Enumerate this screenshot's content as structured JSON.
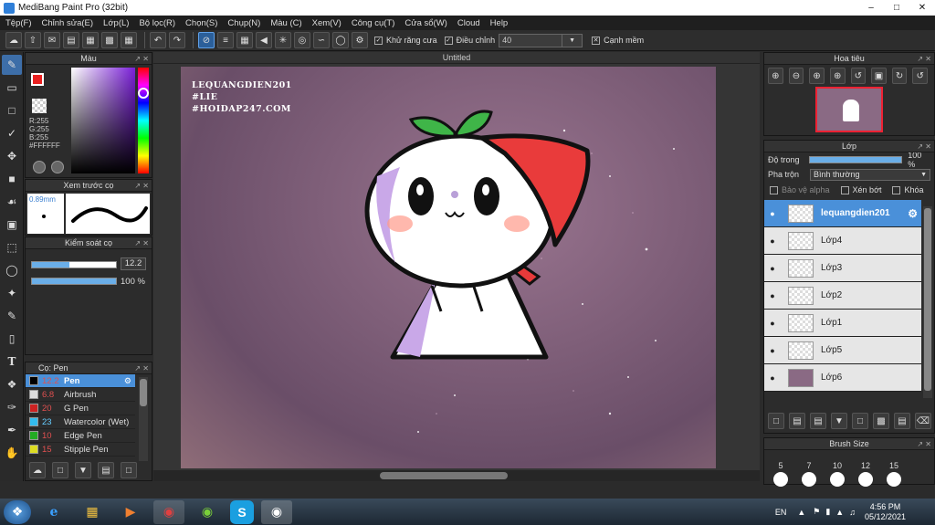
{
  "app": {
    "title": "MediBang Paint Pro (32bit)"
  },
  "menu": [
    "Tệp(F)",
    "Chỉnh sửa(E)",
    "Lớp(L)",
    "Bộ lọc(R)",
    "Chọn(S)",
    "Chụp(N)",
    "Màu (C)",
    "Xem(V)",
    "Công cụ(T)",
    "Cửa sổ(W)",
    "Cloud",
    "Help"
  ],
  "toolbar": {
    "antialias_label": "Khử răng cưa",
    "adjust_label": "Điều chỉnh",
    "adjust_value": "40",
    "edge_label": "Cạnh mềm"
  },
  "color_panel": {
    "title": "Màu",
    "r": "R:255",
    "g": "G:255",
    "b": "B:255",
    "hex": "#FFFFFF",
    "primary": "#e82020",
    "secondary": "#ffffff"
  },
  "brush_preview": {
    "title": "Xem trước cọ",
    "size": "0.89mm"
  },
  "brush_control": {
    "title": "Kiểm soát cọ",
    "size_value": "12.2",
    "opacity_value": "100 %",
    "size_fraction": 0.45,
    "opacity_fraction": 1.0
  },
  "brush_list": {
    "title": "Cọ: Pen",
    "items": [
      {
        "size": "12.2",
        "name": "Pen",
        "color": "#000000"
      },
      {
        "size": "6.8",
        "name": "Airbrush",
        "color": "#dddddd"
      },
      {
        "size": "20",
        "name": "G Pen",
        "color": "#cc2222"
      },
      {
        "size": "23",
        "name": "Watercolor (Wet)",
        "color": "#33bbee"
      },
      {
        "size": "10",
        "name": "Edge Pen",
        "color": "#22aa22"
      },
      {
        "size": "15",
        "name": "Stipple Pen",
        "color": "#dddd22"
      }
    ]
  },
  "canvas": {
    "tab_title": "Untitled",
    "watermark": [
      "LEQUANGDIEN201",
      "#LIE",
      "#HOIDAP247.COM"
    ]
  },
  "navigator": {
    "title": "Hoa tiêu"
  },
  "layers": {
    "title": "Lớp",
    "opacity_label": "Độ trong",
    "opacity_value": "100 %",
    "blend_label": "Pha trộn",
    "blend_value": "Bình thường",
    "protect_alpha": "Bảo vệ alpha",
    "clip": "Xén bớt",
    "lock": "Khóa",
    "items": [
      {
        "name": "lequangdien201"
      },
      {
        "name": "Lớp4"
      },
      {
        "name": "Lớp3"
      },
      {
        "name": "Lớp2"
      },
      {
        "name": "Lớp1"
      },
      {
        "name": "Lớp5"
      },
      {
        "name": "Lớp6"
      }
    ]
  },
  "brush_size_panel": {
    "title": "Brush Size",
    "sizes": [
      "5",
      "7",
      "10",
      "12",
      "15"
    ]
  },
  "taskbar": {
    "lang": "EN",
    "time": "4:56 PM",
    "date": "05/12/2021"
  }
}
